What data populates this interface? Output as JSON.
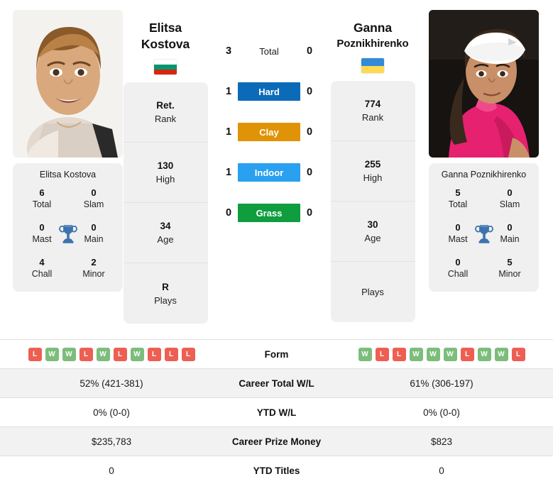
{
  "players": {
    "left": {
      "first_name": "Elitsa",
      "last_name": "Kostova",
      "flag_name": "bulgaria-flag",
      "flag_colors": [
        "#ffffff",
        "#00966e",
        "#d62612"
      ],
      "photo_name": "player-photo-elitsa-kostova",
      "card_name": "Elitsa Kostova",
      "titles": [
        {
          "value": "6",
          "label": "Total"
        },
        {
          "value": "0",
          "label": "Slam"
        },
        {
          "value": "0",
          "label": "Mast"
        },
        {
          "value": "0",
          "label": "Main"
        },
        {
          "value": "4",
          "label": "Chall"
        },
        {
          "value": "2",
          "label": "Minor"
        }
      ],
      "info": [
        {
          "value": "Ret.",
          "label": "Rank"
        },
        {
          "value": "130",
          "label": "High"
        },
        {
          "value": "34",
          "label": "Age"
        },
        {
          "value": "R",
          "label": "Plays"
        }
      ],
      "form": [
        "L",
        "W",
        "W",
        "L",
        "W",
        "L",
        "W",
        "L",
        "L",
        "L"
      ],
      "career_total_wl": "52% (421-381)",
      "ytd_wl": "0% (0-0)",
      "career_prize_money": "$235,783",
      "ytd_titles": "0"
    },
    "right": {
      "first_name": "Ganna",
      "last_name": "Poznikhirenko",
      "flag_name": "ukraine-flag",
      "flag_colors": [
        "#338ad8",
        "#ffd950"
      ],
      "photo_name": "player-photo-ganna-poznikhirenko",
      "card_name": "Ganna Poznikhirenko",
      "titles": [
        {
          "value": "5",
          "label": "Total"
        },
        {
          "value": "0",
          "label": "Slam"
        },
        {
          "value": "0",
          "label": "Mast"
        },
        {
          "value": "0",
          "label": "Main"
        },
        {
          "value": "0",
          "label": "Chall"
        },
        {
          "value": "5",
          "label": "Minor"
        }
      ],
      "info": [
        {
          "value": "774",
          "label": "Rank"
        },
        {
          "value": "255",
          "label": "High"
        },
        {
          "value": "30",
          "label": "Age"
        },
        {
          "value": "",
          "label": "Plays"
        }
      ],
      "form": [
        "W",
        "L",
        "L",
        "W",
        "W",
        "W",
        "L",
        "W",
        "W",
        "L"
      ],
      "career_total_wl": "61% (306-197)",
      "ytd_wl": "0% (0-0)",
      "career_prize_money": "$823",
      "ytd_titles": "0"
    }
  },
  "head_to_head": {
    "rows": [
      {
        "left": "3",
        "label": "Total",
        "right": "0",
        "color": "",
        "plain": true
      },
      {
        "left": "1",
        "label": "Hard",
        "right": "0",
        "color": "#0b6bb8",
        "plain": false
      },
      {
        "left": "1",
        "label": "Clay",
        "right": "0",
        "color": "#e09306",
        "plain": false
      },
      {
        "left": "1",
        "label": "Indoor",
        "right": "0",
        "color": "#29a0f0",
        "plain": false
      },
      {
        "left": "0",
        "label": "Grass",
        "right": "0",
        "color": "#0f9d3e",
        "plain": false
      }
    ]
  },
  "table": {
    "rows": [
      {
        "label": "Form",
        "type": "form"
      },
      {
        "label": "Career Total W/L",
        "type": "text",
        "key": "career_total_wl"
      },
      {
        "label": "YTD W/L",
        "type": "text",
        "key": "ytd_wl"
      },
      {
        "label": "Career Prize Money",
        "type": "text",
        "key": "career_prize_money"
      },
      {
        "label": "YTD Titles",
        "type": "text",
        "key": "ytd_titles"
      }
    ]
  },
  "icons": {
    "trophy": "trophy-icon"
  },
  "colors": {
    "badge_win": "#7cbd7c",
    "badge_loss": "#ed5f52",
    "card_bg": "#f0f0f0",
    "row_alt_bg": "#f2f2f2"
  }
}
